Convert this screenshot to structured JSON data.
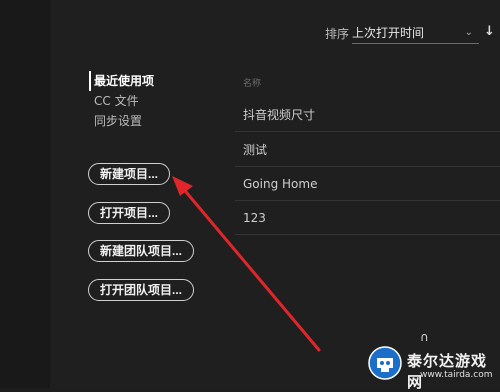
{
  "sort": {
    "label": "排序",
    "selected": "上次打开时间",
    "direction_icon": "arrow-down"
  },
  "nav": {
    "items": [
      {
        "label": "最近使用项",
        "active": true
      },
      {
        "label": "CC 文件",
        "active": false
      },
      {
        "label": "同步设置",
        "active": false
      }
    ]
  },
  "buttons": {
    "new_project": "新建项目...",
    "open_project": "打开项目...",
    "new_team_project": "新建团队项目...",
    "open_team_project": "打开团队项目..."
  },
  "file_list": {
    "header": "名称",
    "rows": [
      "抖音视频尺寸",
      "测试",
      "Going Home",
      "123"
    ]
  },
  "annotation": {
    "arrow_color": "#e0262b"
  },
  "watermark": {
    "title": "泰尔达游戏网",
    "url": "www.tairda.com"
  }
}
